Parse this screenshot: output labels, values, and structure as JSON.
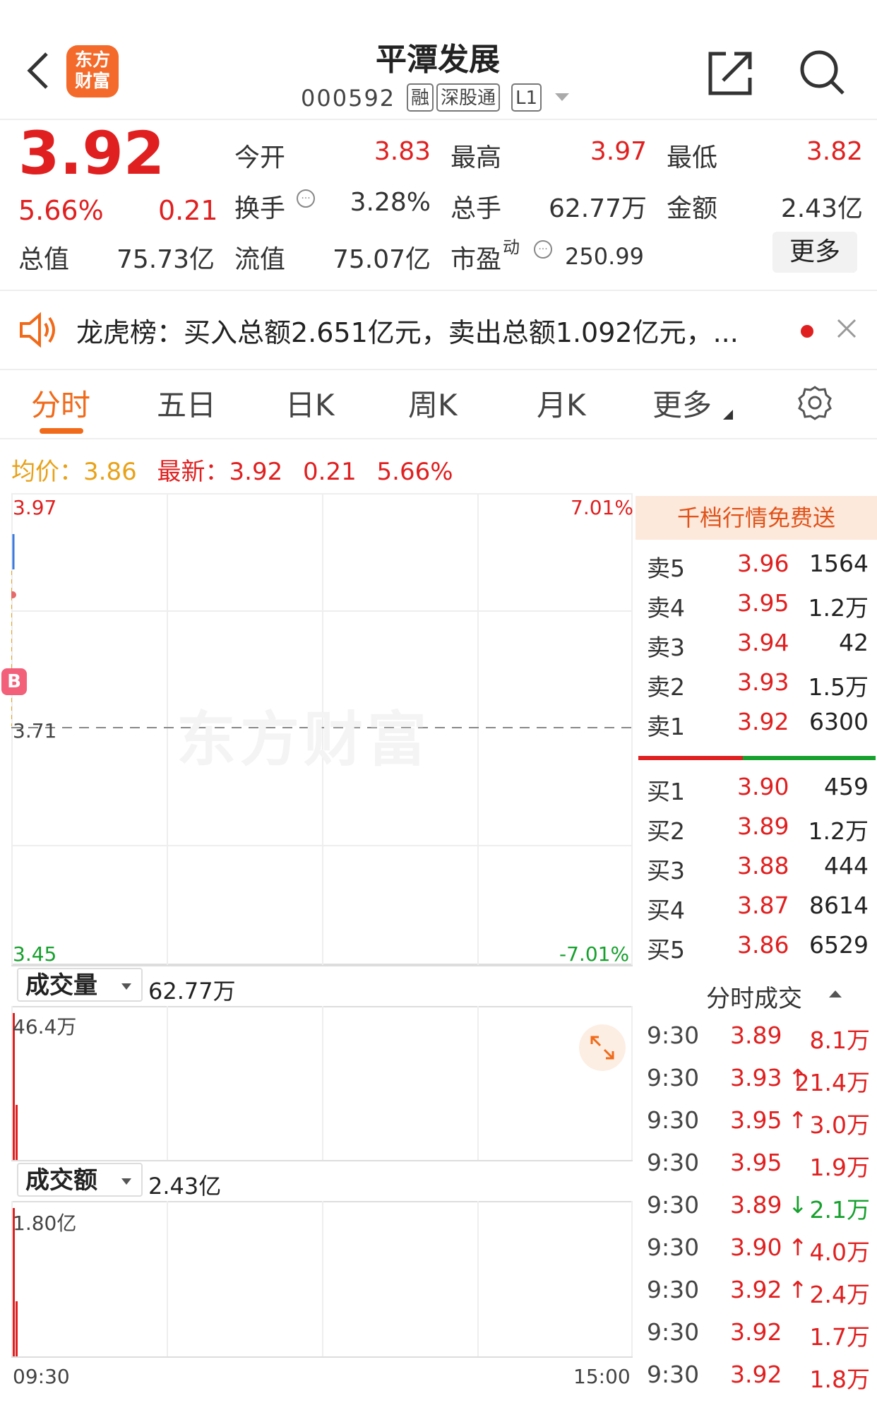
{
  "header": {
    "logo_line1": "东方",
    "logo_line2": "财富",
    "stock_name": "平潭发展",
    "stock_code": "000592",
    "tags": [
      "融",
      "深股通",
      "L1"
    ]
  },
  "quote": {
    "price": "3.92",
    "change_pct": "5.66%",
    "change_val": "0.21",
    "fields": {
      "open_label": "今开",
      "open": "3.83",
      "high_label": "最高",
      "high": "3.97",
      "low_label": "最低",
      "low": "3.82",
      "turnover_label": "换手",
      "turnover": "3.28%",
      "volume_label": "总手",
      "volume": "62.77万",
      "amount_label": "金额",
      "amount": "2.43亿",
      "mktcap_label": "总值",
      "mktcap": "75.73亿",
      "float_label": "流值",
      "float": "75.07亿",
      "pe_label": "市盈",
      "pe_sup": "动",
      "pe": "250.99"
    },
    "more_label": "更多"
  },
  "notice": {
    "text": "龙虎榜：买入总额2.651亿元，卖出总额1.092亿元，..."
  },
  "tabs": [
    "分时",
    "五日",
    "日K",
    "周K",
    "月K",
    "更多"
  ],
  "avg": {
    "avg_label": "均价：",
    "avg_value": "3.86",
    "latest_label": "最新：",
    "latest_value": "3.92",
    "latest_change": "0.21",
    "latest_pct": "5.66%"
  },
  "chart": {
    "y_top": "3.97",
    "y_mid": "3.71",
    "y_bottom": "3.45",
    "pct_top": "7.01%",
    "pct_bottom": "-7.01%",
    "watermark": "东方财富",
    "b_marker": "B",
    "x_start": "09:30",
    "x_end": "15:00"
  },
  "volume_panel": {
    "label": "成交量",
    "total": "62.77万",
    "max": "46.4万"
  },
  "amount_panel": {
    "label": "成交额",
    "total": "2.43亿",
    "max": "1.80亿"
  },
  "orderbook": {
    "banner": "千档行情免费送",
    "sell": [
      {
        "label": "卖5",
        "price": "3.96",
        "qty": "1564"
      },
      {
        "label": "卖4",
        "price": "3.95",
        "qty": "1.2万"
      },
      {
        "label": "卖3",
        "price": "3.94",
        "qty": "42"
      },
      {
        "label": "卖2",
        "price": "3.93",
        "qty": "1.5万"
      },
      {
        "label": "卖1",
        "price": "3.92",
        "qty": "6300"
      }
    ],
    "buy": [
      {
        "label": "买1",
        "price": "3.90",
        "qty": "459"
      },
      {
        "label": "买2",
        "price": "3.89",
        "qty": "1.2万"
      },
      {
        "label": "买3",
        "price": "3.88",
        "qty": "444"
      },
      {
        "label": "买4",
        "price": "3.87",
        "qty": "8614"
      },
      {
        "label": "买5",
        "price": "3.86",
        "qty": "6529"
      }
    ]
  },
  "trades": {
    "title": "分时成交",
    "rows": [
      {
        "time": "9:30",
        "price": "3.89",
        "arrow": "",
        "vol": "8.1万",
        "dir": "red"
      },
      {
        "time": "9:30",
        "price": "3.93",
        "arrow": "↑",
        "vol": "21.4万",
        "dir": "red"
      },
      {
        "time": "9:30",
        "price": "3.95",
        "arrow": "↑",
        "vol": "3.0万",
        "dir": "red"
      },
      {
        "time": "9:30",
        "price": "3.95",
        "arrow": "",
        "vol": "1.9万",
        "dir": "red"
      },
      {
        "time": "9:30",
        "price": "3.89",
        "arrow": "↓",
        "vol": "2.1万",
        "dir": "green"
      },
      {
        "time": "9:30",
        "price": "3.90",
        "arrow": "↑",
        "vol": "4.0万",
        "dir": "red"
      },
      {
        "time": "9:30",
        "price": "3.92",
        "arrow": "↑",
        "vol": "2.4万",
        "dir": "red"
      },
      {
        "time": "9:30",
        "price": "3.92",
        "arrow": "",
        "vol": "1.7万",
        "dir": "red"
      },
      {
        "time": "9:30",
        "price": "3.92",
        "arrow": "",
        "vol": "1.8万",
        "dir": "red"
      }
    ]
  }
}
